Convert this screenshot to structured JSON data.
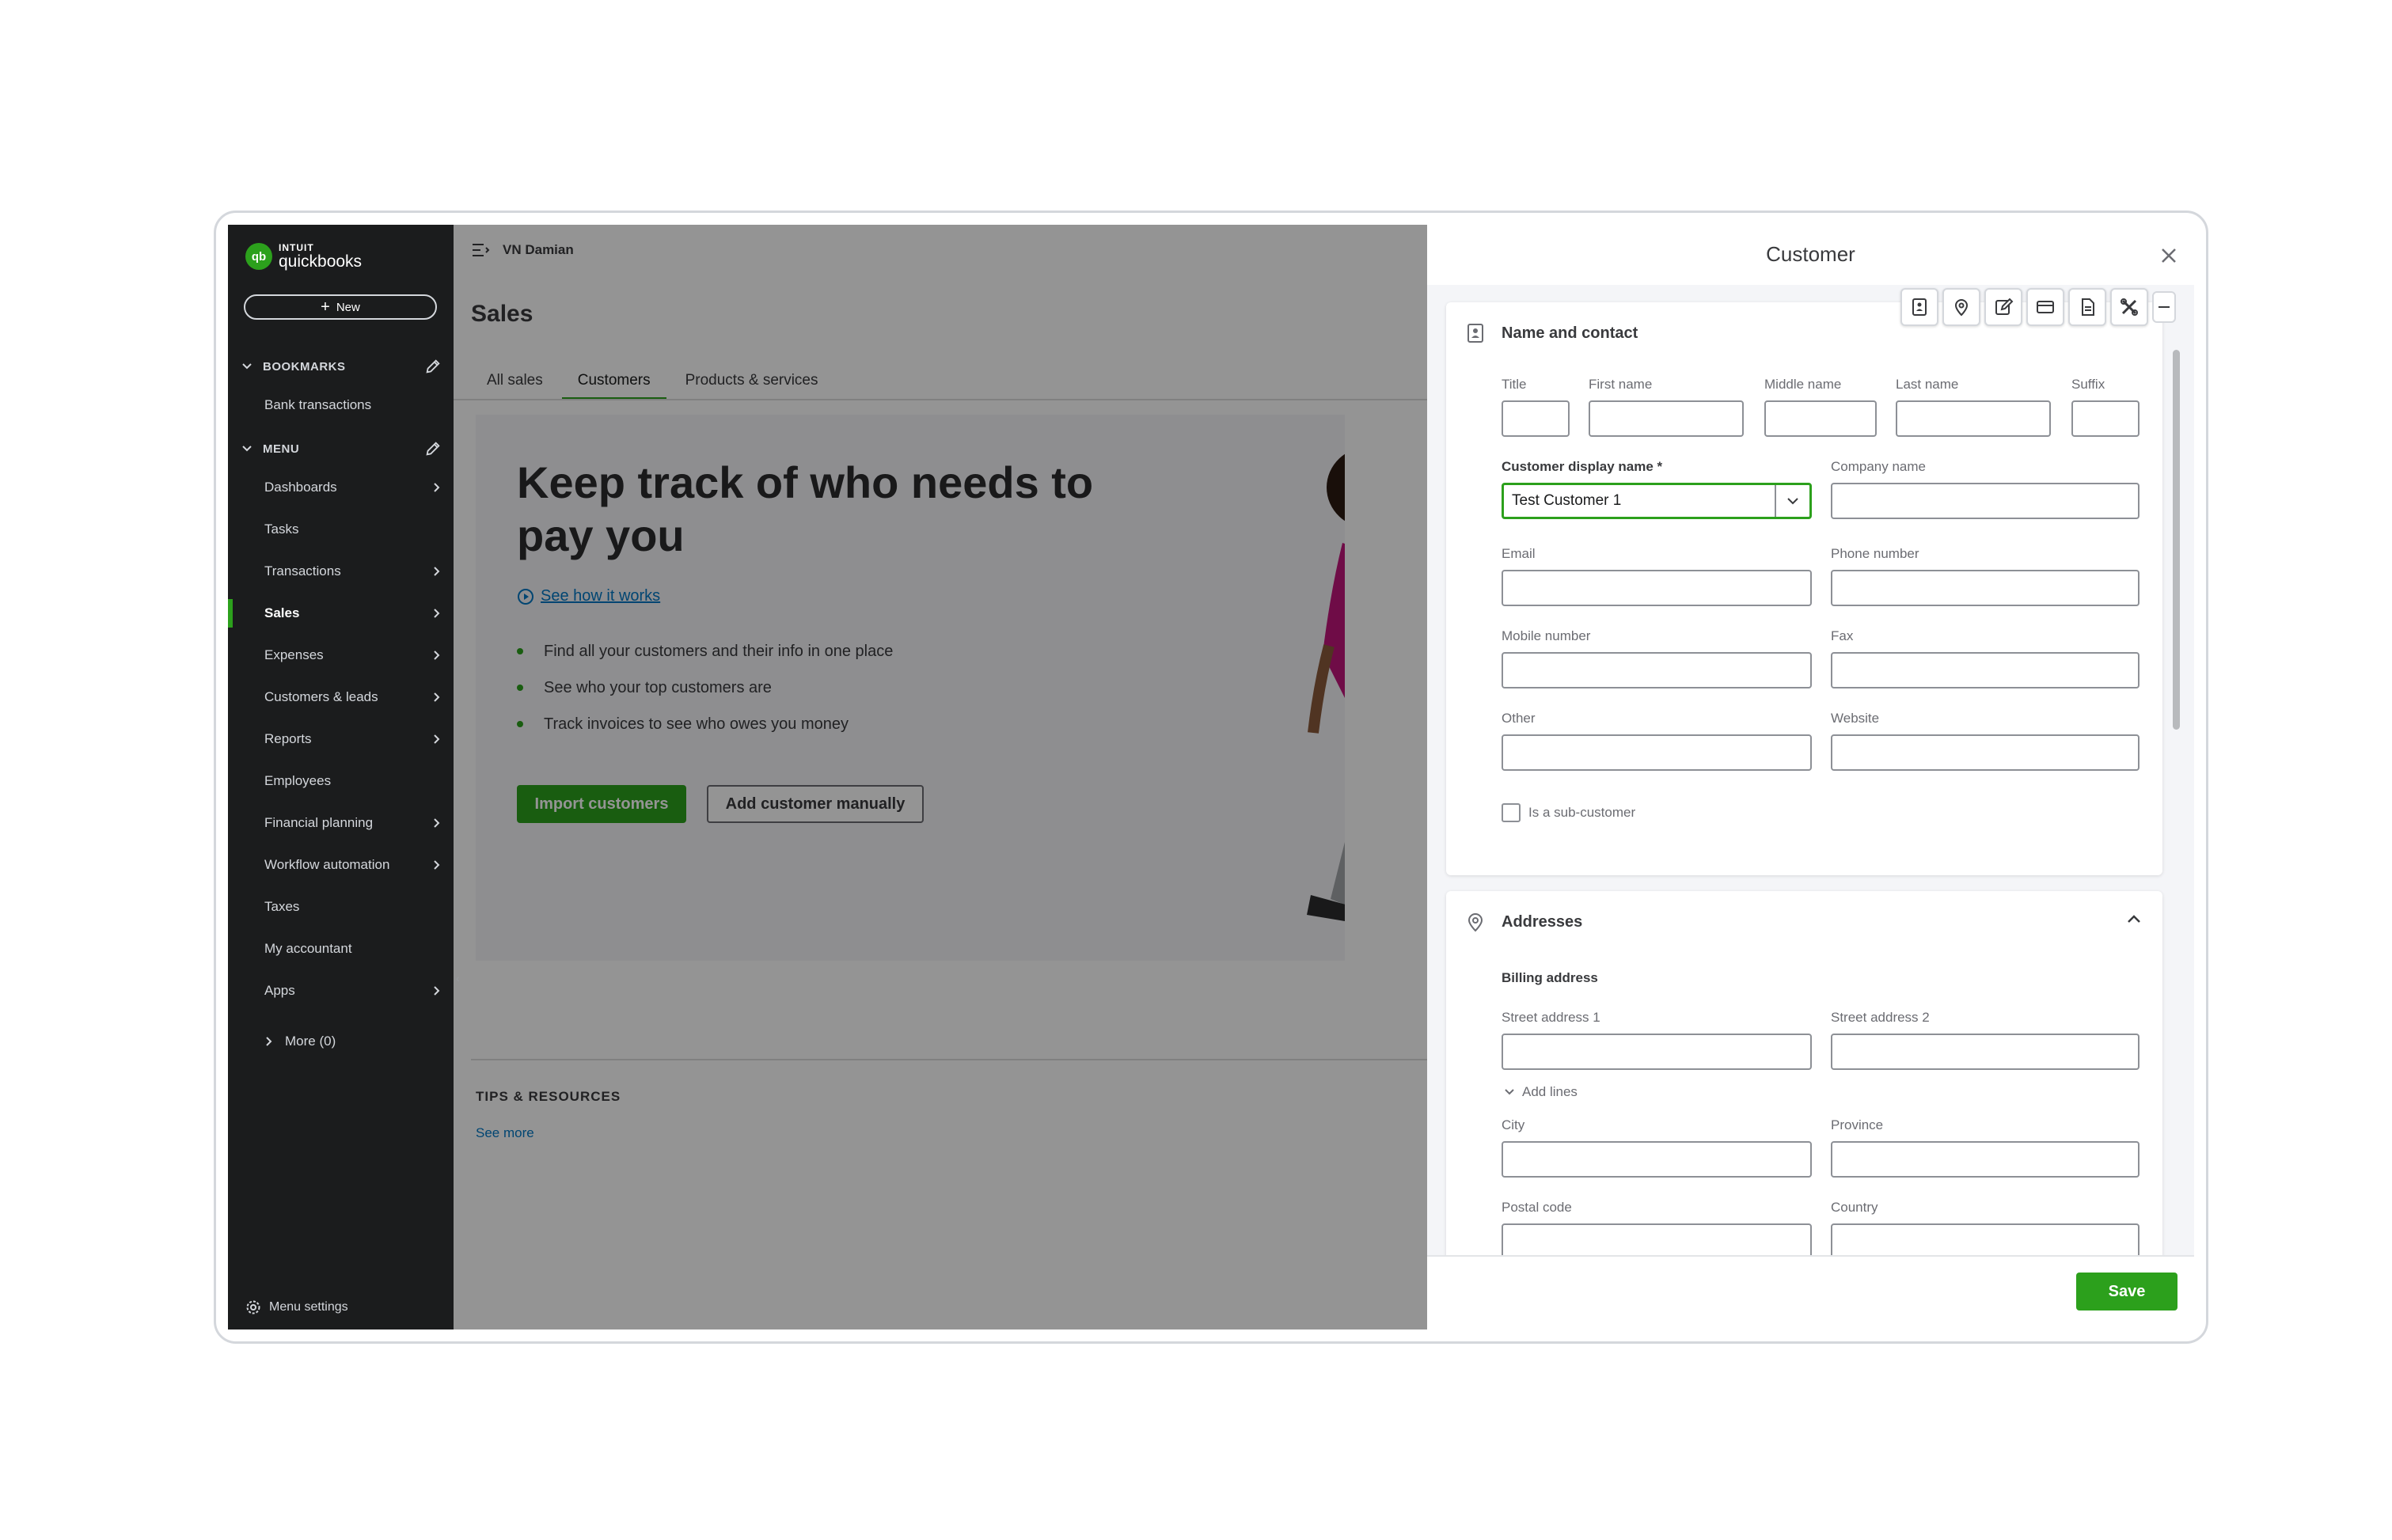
{
  "sidebar": {
    "logo_intuit": "INTUIT",
    "logo_qb": "quickbooks",
    "new_label": "New",
    "bookmarks_label": "BOOKMARKS",
    "bookmarks": [
      "Bank transactions"
    ],
    "menu_label": "MENU",
    "items": [
      {
        "label": "Dashboards",
        "arrow": true
      },
      {
        "label": "Tasks",
        "arrow": false
      },
      {
        "label": "Transactions",
        "arrow": true
      },
      {
        "label": "Sales",
        "arrow": true,
        "active": true
      },
      {
        "label": "Expenses",
        "arrow": true
      },
      {
        "label": "Customers & leads",
        "arrow": true
      },
      {
        "label": "Reports",
        "arrow": true
      },
      {
        "label": "Employees",
        "arrow": false
      },
      {
        "label": "Financial planning",
        "arrow": true
      },
      {
        "label": "Workflow automation",
        "arrow": true
      },
      {
        "label": "Taxes",
        "arrow": false
      },
      {
        "label": "My accountant",
        "arrow": false
      },
      {
        "label": "Apps",
        "arrow": true
      }
    ],
    "more_label": "More (0)",
    "menu_settings": "Menu settings"
  },
  "main": {
    "company": "VN Damian",
    "page_title": "Sales",
    "tabs": [
      {
        "label": "All sales",
        "active": false
      },
      {
        "label": "Customers",
        "active": true
      },
      {
        "label": "Products & services",
        "active": false
      }
    ],
    "hero": {
      "title": "Keep track of who needs to pay you",
      "link": "See how it works",
      "bullets": [
        "Find all your customers and their info in one place",
        "See who your top customers are",
        "Track invoices to see who owes you money"
      ],
      "import_btn": "Import customers",
      "manual_btn": "Add customer manually"
    },
    "tips_title": "TIPS & RESOURCES",
    "tips_link": "See more"
  },
  "drawer": {
    "title": "Customer",
    "name_contact": {
      "heading": "Name and contact",
      "title_label": "Title",
      "first_label": "First name",
      "middle_label": "Middle name",
      "last_label": "Last name",
      "suffix_label": "Suffix",
      "display_label": "Customer display name *",
      "display_value": "Test Customer 1",
      "company_label": "Company name",
      "email_label": "Email",
      "phone_label": "Phone number",
      "mobile_label": "Mobile number",
      "fax_label": "Fax",
      "other_label": "Other",
      "website_label": "Website",
      "subcustomer_label": "Is a sub-customer"
    },
    "addresses": {
      "heading": "Addresses",
      "billing_label": "Billing address",
      "street1_label": "Street address 1",
      "street2_label": "Street address 2",
      "add_lines": "Add lines",
      "city_label": "City",
      "province_label": "Province",
      "postal_label": "Postal code",
      "country_label": "Country"
    },
    "save_label": "Save"
  },
  "colors": {
    "brand_green": "#2ca01c",
    "sidebar_bg": "#1b1c1d",
    "link_blue": "#0077c5"
  }
}
